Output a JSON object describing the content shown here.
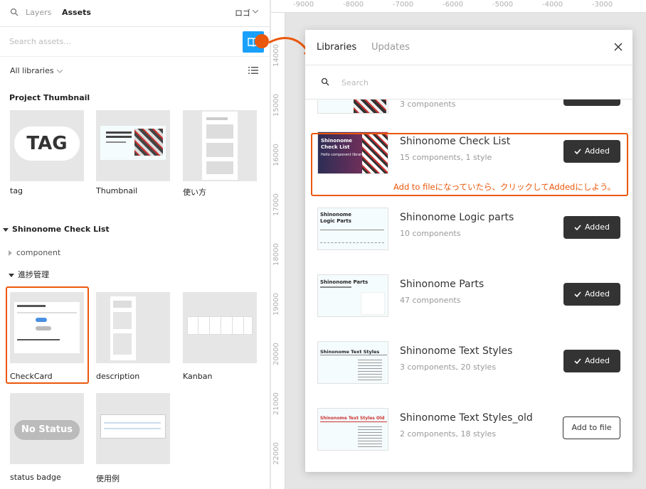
{
  "left_panel": {
    "tabs": {
      "layers": "Layers",
      "assets": "Assets"
    },
    "file_name": "ロゴ",
    "search_placeholder": "Search assets...",
    "library_selector": "All libraries",
    "sections": [
      {
        "title": "Project Thumbnail",
        "items": [
          "tag",
          "Thumbnail",
          "使い方"
        ]
      },
      {
        "title": "Shinonome Check List",
        "groups": [
          "component",
          "進捗管理"
        ],
        "items": [
          "CheckCard",
          "description",
          "Kanban",
          "status badge",
          "使用例"
        ]
      }
    ],
    "thumb_text": {
      "tag": "TAG",
      "status": "No Status"
    }
  },
  "rulers": {
    "top": [
      "-9000",
      "-8000",
      "-7000",
      "-6000",
      "-5000",
      "-4000",
      "-3000"
    ],
    "left": [
      "14000",
      "15000",
      "16000",
      "17000",
      "18000",
      "19000",
      "20000",
      "21000",
      "22000"
    ]
  },
  "modal": {
    "tabs": {
      "libraries": "Libraries",
      "updates": "Updates"
    },
    "search_placeholder": "Search",
    "partial_row_meta": "3 components",
    "libraries": [
      {
        "name": "Shinonome Check List",
        "meta": "15 components, 1 style",
        "button": "Added"
      },
      {
        "name": "Shinonome Logic parts",
        "meta": "10 components",
        "button": "Added"
      },
      {
        "name": "Shinonome Parts",
        "meta": "47 components",
        "button": "Added"
      },
      {
        "name": "Shinonome Text Styles",
        "meta": "3 components, 20 styles",
        "button": "Added"
      },
      {
        "name": "Shinonome Text Styles_old",
        "meta": "2 components, 18 styles",
        "button": "Add to file"
      }
    ],
    "thumb_text": {
      "checklist": "Shinonome Check List",
      "checklist_sub": "Hello component library",
      "logic": "Shinonome Logic Parts",
      "parts": "Shinonome Parts",
      "text": "Shinonome Text Styles",
      "textold": "Shinonome Text Styles Old"
    }
  },
  "annotation": "Add to fileになっていたら、クリックしてAddedにしよう。",
  "colors": {
    "accent": "#ea580c",
    "primary_blue": "#18a0fb",
    "dark_button": "#333333"
  }
}
